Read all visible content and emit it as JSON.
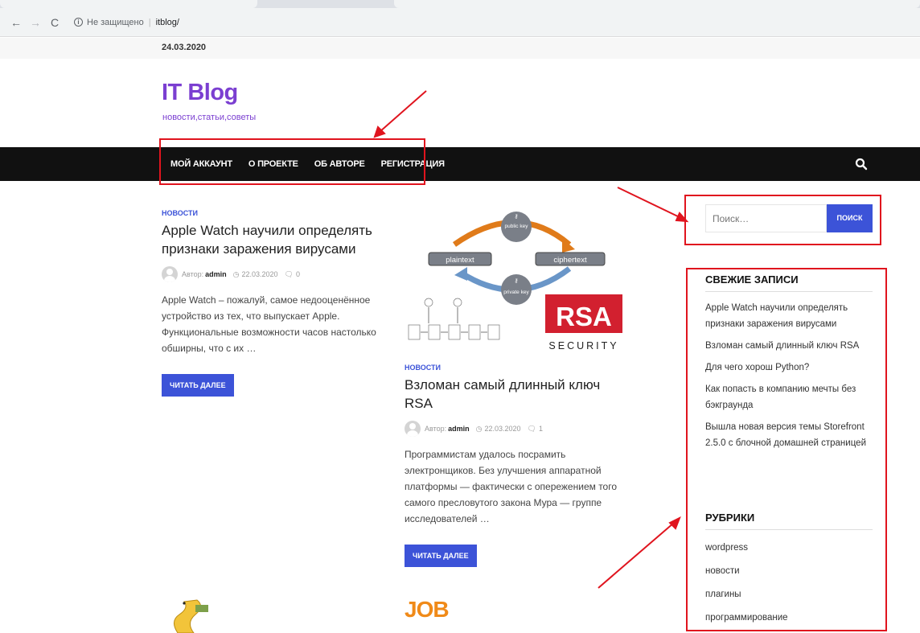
{
  "browser": {
    "back_icon": "←",
    "forward_icon": "→",
    "reload_icon": "C",
    "security_label": "Не защищено",
    "url": "itblog/"
  },
  "site": {
    "date": "24.03.2020",
    "title": "IT Blog",
    "description": "новости,статьи,советы"
  },
  "nav": {
    "items": [
      "МОЙ АККАУНТ",
      "О ПРОЕКТЕ",
      "ОБ АВТОРЕ",
      "РЕГИСТРАЦИЯ"
    ]
  },
  "posts": [
    {
      "category": "НОВОСТИ",
      "title": "Apple Watch научили определять признаки заражения вирусами",
      "author_label": "Автор:",
      "author": "admin",
      "date": "22.03.2020",
      "comments": "0",
      "excerpt": "Apple Watch – пожалуй, самое недооценённое устройство из тех, что выпускает Apple. Функциональные возможности часов настолько обширны, что с их …",
      "read_more": "ЧИТАТЬ ДАЛЕЕ"
    },
    {
      "category": "НОВОСТИ",
      "title": "Взломан самый длинный ключ RSA",
      "author_label": "Автор:",
      "author": "admin",
      "date": "22.03.2020",
      "comments": "1",
      "excerpt": "Программистам удалось посрамить электронщиков. Без улучшения аппаратной платформы — фактически с опережением того самого пресловутого закона Мура — группе исследователей …",
      "read_more": "ЧИТАТЬ ДАЛЕЕ"
    }
  ],
  "rsa_image": {
    "public_key": "public key",
    "private_key": "private key",
    "plaintext": "plaintext",
    "ciphertext": "ciphertext",
    "logo": "RSA",
    "security": "SECURITY"
  },
  "job_image": {
    "text": "JOB"
  },
  "sidebar": {
    "search_placeholder": "Поиск…",
    "search_button": "ПОИСК",
    "recent_title": "СВЕЖИЕ ЗАПИСИ",
    "recent": [
      "Apple Watch научили определять признаки заражения вирусами",
      "Взломан самый длинный ключ RSA",
      "Для чего хорош Python?",
      "Как попасть в компанию мечты без бэкграунда",
      "Вышла новая версия темы Storefront 2.5.0 с блочной домашней страницей"
    ],
    "categories_title": "РУБРИКИ",
    "categories": [
      "wordpress",
      "новости",
      "плагины",
      "программирование"
    ]
  },
  "colors": {
    "accent": "#3c53d8",
    "brand": "#7b3fd1",
    "navbar": "#111111",
    "annotation": "#e0141e"
  }
}
